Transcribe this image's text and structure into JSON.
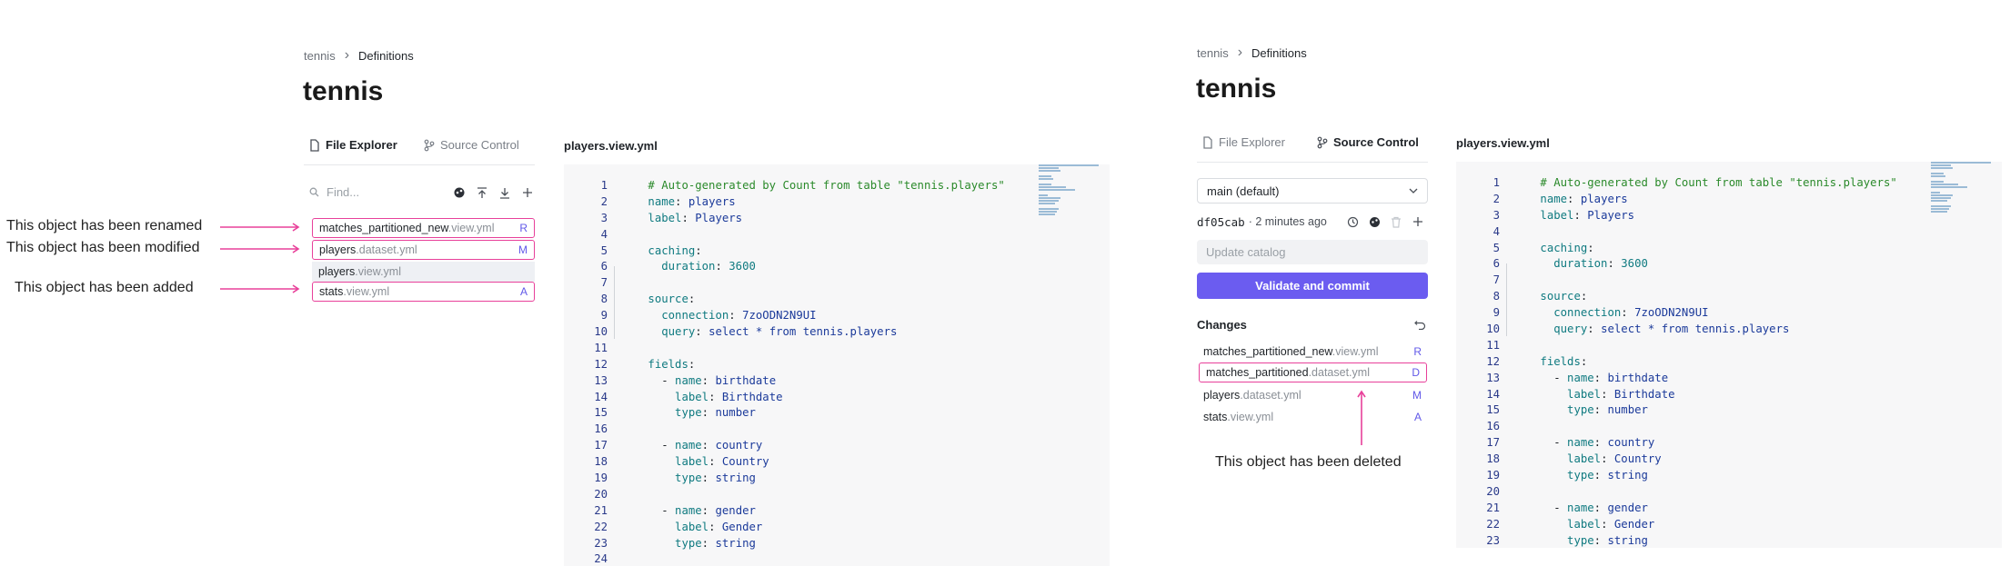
{
  "left": {
    "breadcrumb": {
      "root": "tennis",
      "current": "Definitions"
    },
    "title": "tennis",
    "tabs": [
      {
        "label": "File Explorer",
        "icon": "file-icon",
        "active": true
      },
      {
        "label": "Source Control",
        "icon": "branch-icon",
        "active": false
      }
    ],
    "find_placeholder": "Find...",
    "files": [
      {
        "name": "matches_partitioned_new",
        "ext": ".view.yml",
        "status": "R"
      },
      {
        "name": "players",
        "ext": ".dataset.yml",
        "status": "M"
      },
      {
        "name": "players",
        "ext": ".view.yml",
        "status": ""
      },
      {
        "name": "stats",
        "ext": ".view.yml",
        "status": "A"
      }
    ],
    "annotations": [
      "This object has been renamed",
      "This object has been modified",
      "This object has been added"
    ],
    "editor_title": "players.view.yml"
  },
  "right": {
    "breadcrumb": {
      "root": "tennis",
      "current": "Definitions"
    },
    "title": "tennis",
    "tabs": [
      {
        "label": "File Explorer",
        "icon": "file-icon",
        "active": false
      },
      {
        "label": "Source Control",
        "icon": "branch-icon",
        "active": true
      }
    ],
    "branch": "main (default)",
    "commit": "df05cab",
    "commit_time": "· 2 minutes ago",
    "update_placeholder": "Update catalog",
    "validate_label": "Validate and commit",
    "changes_label": "Changes",
    "changes": [
      {
        "name": "matches_partitioned_new",
        "ext": ".view.yml",
        "status": "R"
      },
      {
        "name": "matches_partitioned",
        "ext": ".dataset.yml",
        "status": "D"
      },
      {
        "name": "players",
        "ext": ".dataset.yml",
        "status": "M"
      },
      {
        "name": "stats",
        "ext": ".view.yml",
        "status": "A"
      }
    ],
    "annotation": "This object has been deleted",
    "editor_title": "players.view.yml"
  },
  "code": [
    {
      "n": "1",
      "t": [
        [
          "c-com",
          "# Auto-generated by Count from table \"tennis.players\""
        ]
      ]
    },
    {
      "n": "2",
      "t": [
        [
          "c-key",
          "name"
        ],
        [
          "c-pl",
          ": "
        ],
        [
          "c-val",
          "players"
        ]
      ]
    },
    {
      "n": "3",
      "t": [
        [
          "c-key",
          "label"
        ],
        [
          "c-pl",
          ": "
        ],
        [
          "c-val",
          "Players"
        ]
      ]
    },
    {
      "n": "4",
      "t": []
    },
    {
      "n": "5",
      "t": [
        [
          "c-key",
          "caching"
        ],
        [
          "c-pl",
          ":"
        ]
      ]
    },
    {
      "n": "6",
      "t": [
        [
          "c-pl",
          "  "
        ],
        [
          "c-key",
          "duration"
        ],
        [
          "c-pl",
          ": "
        ],
        [
          "c-key",
          "3600"
        ]
      ]
    },
    {
      "n": "7",
      "t": []
    },
    {
      "n": "8",
      "t": [
        [
          "c-key",
          "source"
        ],
        [
          "c-pl",
          ":"
        ]
      ]
    },
    {
      "n": "9",
      "t": [
        [
          "c-pl",
          "  "
        ],
        [
          "c-key",
          "connection"
        ],
        [
          "c-pl",
          ": "
        ],
        [
          "c-val",
          "7zoODN2N9UI"
        ]
      ]
    },
    {
      "n": "10",
      "t": [
        [
          "c-pl",
          "  "
        ],
        [
          "c-key",
          "query"
        ],
        [
          "c-pl",
          ": "
        ],
        [
          "c-val",
          "select * from tennis.players"
        ]
      ]
    },
    {
      "n": "11",
      "t": []
    },
    {
      "n": "12",
      "t": [
        [
          "c-key",
          "fields"
        ],
        [
          "c-pl",
          ":"
        ]
      ]
    },
    {
      "n": "13",
      "t": [
        [
          "c-pl",
          "  - "
        ],
        [
          "c-key",
          "name"
        ],
        [
          "c-pl",
          ": "
        ],
        [
          "c-val",
          "birthdate"
        ]
      ]
    },
    {
      "n": "14",
      "t": [
        [
          "c-pl",
          "    "
        ],
        [
          "c-key",
          "label"
        ],
        [
          "c-pl",
          ": "
        ],
        [
          "c-val",
          "Birthdate"
        ]
      ]
    },
    {
      "n": "15",
      "t": [
        [
          "c-pl",
          "    "
        ],
        [
          "c-key",
          "type"
        ],
        [
          "c-pl",
          ": "
        ],
        [
          "c-val",
          "number"
        ]
      ]
    },
    {
      "n": "16",
      "t": []
    },
    {
      "n": "17",
      "t": [
        [
          "c-pl",
          "  - "
        ],
        [
          "c-key",
          "name"
        ],
        [
          "c-pl",
          ": "
        ],
        [
          "c-val",
          "country"
        ]
      ]
    },
    {
      "n": "18",
      "t": [
        [
          "c-pl",
          "    "
        ],
        [
          "c-key",
          "label"
        ],
        [
          "c-pl",
          ": "
        ],
        [
          "c-val",
          "Country"
        ]
      ]
    },
    {
      "n": "19",
      "t": [
        [
          "c-pl",
          "    "
        ],
        [
          "c-key",
          "type"
        ],
        [
          "c-pl",
          ": "
        ],
        [
          "c-val",
          "string"
        ]
      ]
    },
    {
      "n": "20",
      "t": []
    },
    {
      "n": "21",
      "t": [
        [
          "c-pl",
          "  - "
        ],
        [
          "c-key",
          "name"
        ],
        [
          "c-pl",
          ": "
        ],
        [
          "c-val",
          "gender"
        ]
      ]
    },
    {
      "n": "22",
      "t": [
        [
          "c-pl",
          "    "
        ],
        [
          "c-key",
          "label"
        ],
        [
          "c-pl",
          ": "
        ],
        [
          "c-val",
          "Gender"
        ]
      ]
    },
    {
      "n": "23",
      "t": [
        [
          "c-pl",
          "    "
        ],
        [
          "c-key",
          "type"
        ],
        [
          "c-pl",
          ": "
        ],
        [
          "c-val",
          "string"
        ]
      ]
    },
    {
      "n": "24",
      "t": []
    }
  ],
  "colors": {
    "accent": "#6b5cf0",
    "highlight": "#e8409a",
    "status": "#6158e8"
  }
}
